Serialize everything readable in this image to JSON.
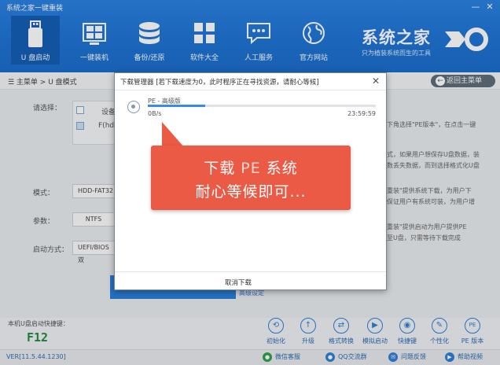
{
  "window": {
    "title": "系统之家一键重装",
    "min_label": "—",
    "close_label": "✕"
  },
  "nav": [
    {
      "label": "U 盘启动",
      "icon": "usb-drive-icon",
      "active": true
    },
    {
      "label": "一键装机",
      "icon": "windows-logo-icon",
      "active": false
    },
    {
      "label": "备份/还原",
      "icon": "database-icon",
      "active": false
    },
    {
      "label": "软件大全",
      "icon": "apps-grid-icon",
      "active": false
    },
    {
      "label": "人工服务",
      "icon": "chat-icon",
      "active": false
    },
    {
      "label": "官方网站",
      "icon": "globe-icon",
      "active": false
    }
  ],
  "brand": {
    "name": "系统之家",
    "tagline": "只为植装系统而生的工具"
  },
  "breadcrumb": {
    "text": "☰ 主菜单 > U 盘模式"
  },
  "back_button": {
    "label": "返回主菜单",
    "icon": "back-arrow-icon"
  },
  "background": {
    "select_label": "请选择：",
    "device_label": "设备",
    "device_row": "F(hd",
    "mode_label": "模式：",
    "mode_value": "HDD-FAT32",
    "param_label": "参数：",
    "param_value": "NTFS",
    "boot_label": "启动方式：",
    "boot_value": "UEFI/BIOS双",
    "right_lines": [
      "下角选择\"PE版本\"，在点击一键",
      "式，如果用户想保存U盘数据，装",
      "数丢失数据，而到选择格式化U盘",
      "重装\"提供系统下载，为用户下",
      "保证用户有系统可装，为用户增",
      "重装\"提供启动为用户提供PE",
      "至U盘，只需等待下载完成"
    ],
    "link": "高级设定"
  },
  "hotkey": {
    "label": "本机U盘启动快捷键：",
    "key": "F12"
  },
  "tools": [
    {
      "label": "初始化",
      "icon": "reset-icon",
      "glyph": "⟲"
    },
    {
      "label": "升级",
      "icon": "upgrade-icon",
      "glyph": "↑"
    },
    {
      "label": "格式转换",
      "icon": "convert-icon",
      "glyph": "⇄"
    },
    {
      "label": "模拟启动",
      "icon": "simulate-icon",
      "glyph": "▶"
    },
    {
      "label": "快捷键",
      "icon": "mouse-icon",
      "glyph": "◉"
    },
    {
      "label": "个性化",
      "icon": "personalize-icon",
      "glyph": "✎"
    },
    {
      "label": "PE 版本",
      "icon": "pe-icon",
      "glyph": "PE"
    }
  ],
  "status": {
    "version": "VER[11.5.44.1230]",
    "items": [
      {
        "label": "微信客服",
        "icon": "wechat-icon",
        "color": "#2fa24a"
      },
      {
        "label": "QQ交流群",
        "icon": "qq-icon",
        "color": "#2f80d6"
      },
      {
        "label": "问题反馈",
        "icon": "feedback-icon",
        "color": "#2f80d6"
      },
      {
        "label": "帮助视频",
        "icon": "video-help-icon",
        "color": "#2f80d6"
      }
    ]
  },
  "dialog": {
    "title": "下载管理器 [若下载速度为0，此时程序正在寻找资源，请耐心等候]",
    "close_label": "✕",
    "item": {
      "name": "PE - 高级版",
      "speed": "0B/s",
      "eta": "23:59:59",
      "progress": 0.25
    },
    "cancel_label": "取消下载"
  },
  "callout": {
    "line1_prefix": "下载 ",
    "line1_pe": "PE",
    "line1_suffix": " 系统",
    "line2": "耐心等候即可..."
  },
  "colors": {
    "header": "#1f74d4",
    "callout": "#ea5a45",
    "accent": "#2f80d6",
    "hotkey": "#1e8e3e"
  }
}
